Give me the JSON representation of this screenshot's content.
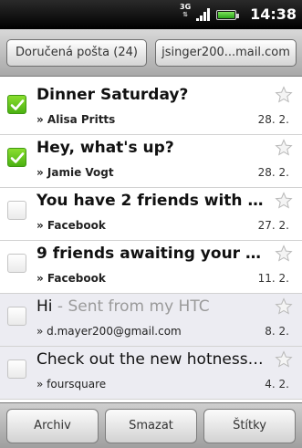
{
  "status_bar": {
    "network": "3G",
    "time": "14:38",
    "icons": [
      "3g-data-icon",
      "signal-icon",
      "battery-icon"
    ]
  },
  "header": {
    "inbox_label": "Doručená pošta (24)",
    "account_label": "jsinger200...mail.com"
  },
  "messages": [
    {
      "subject": "Dinner Saturday?",
      "preview": "",
      "sender": "» Alisa Pritts",
      "date": "28. 2.",
      "checked": true,
      "unread": true
    },
    {
      "subject": "Hey, what's up?",
      "preview": "",
      "sender": "» Jamie Vogt",
      "date": "28. 2.",
      "checked": true,
      "unread": true
    },
    {
      "subject": "You have 2 friends with b...",
      "preview": "",
      "sender": "» Facebook",
      "date": "27. 2.",
      "checked": false,
      "unread": true
    },
    {
      "subject": "9 friends awaiting your re...",
      "preview": "",
      "sender": "» Facebook",
      "date": "11. 2.",
      "checked": false,
      "unread": true
    },
    {
      "subject": "Hi",
      "preview": " - Sent from my HTC",
      "sender": "» d.mayer200@gmail.com",
      "date": "8. 2.",
      "checked": false,
      "unread": false
    },
    {
      "subject": "Check out the new hotness ...",
      "preview": "",
      "sender": "» foursquare",
      "date": "4. 2.",
      "checked": false,
      "unread": false
    }
  ],
  "toolbar": {
    "archive_label": "Archiv",
    "delete_label": "Smazat",
    "labels_label": "Štítky"
  },
  "colors": {
    "check_green": "#4bb112",
    "read_row_bg": "#ececf2"
  }
}
